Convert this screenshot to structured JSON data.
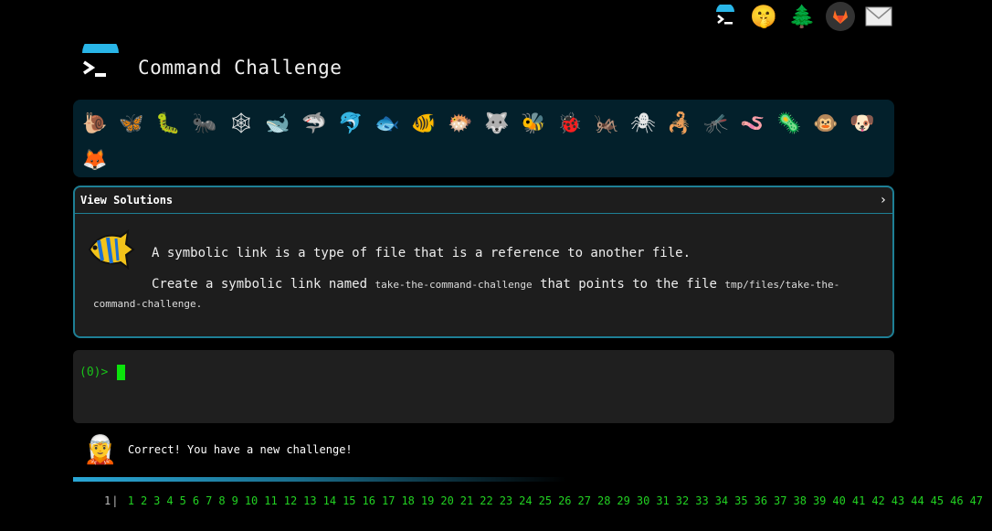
{
  "header": {
    "title": "Command Challenge",
    "top_icons": [
      "terminal-logo-icon",
      "shushing-face-icon",
      "tree-icon",
      "gitlab-icon",
      "mail-icon"
    ]
  },
  "critters": [
    "🐌",
    "🦋",
    "🐛",
    "🐜",
    "🕸",
    "🐋",
    "🦈",
    "🐬",
    "🐟",
    "🐠",
    "🐡",
    "🐺",
    "🐝",
    "🐞",
    "🦗",
    "🕷",
    "🦂",
    "🦟",
    "🪱",
    "🦠",
    "🐵",
    "🐶",
    "🦊"
  ],
  "solution": {
    "toggle_label": "View Solutions",
    "chevron": "›",
    "intro": "A symbolic link is a type of file that is a reference to another file.",
    "task_prefix": "Create a symbolic link named",
    "link_name": "take-the-command-challenge",
    "task_middle": "that points to the file",
    "target_path": "tmp/files/take-the-command-challenge",
    "task_suffix": "."
  },
  "terminal": {
    "prompt": "(0)>"
  },
  "status": {
    "message": "Correct! You have a new challenge!",
    "progress": 0.5
  },
  "pagination": {
    "current": "1",
    "pages": [
      "1",
      "2",
      "3",
      "4",
      "5",
      "6",
      "7",
      "8",
      "9",
      "10",
      "11",
      "12",
      "13",
      "14",
      "15",
      "16",
      "17",
      "18",
      "19",
      "20",
      "21",
      "22",
      "23",
      "24",
      "25",
      "26",
      "27",
      "28",
      "29",
      "30",
      "31",
      "32",
      "33",
      "34",
      "35",
      "36",
      "37",
      "38",
      "39",
      "40",
      "41",
      "42",
      "43",
      "44",
      "45",
      "46",
      "47"
    ]
  },
  "colors": {
    "accent": "#1e7f95",
    "prompt_green": "#19c219",
    "link_green": "#22d122",
    "critter_bg": "#03202b"
  }
}
